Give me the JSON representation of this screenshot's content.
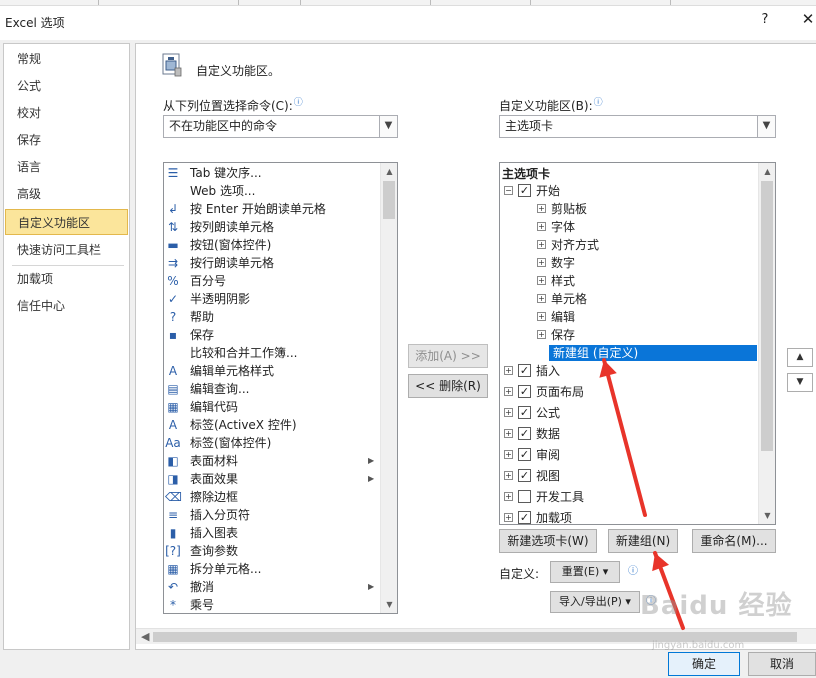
{
  "window": {
    "title": "Excel 选项",
    "help": "?",
    "close": "✕"
  },
  "nav": {
    "items": [
      {
        "label": "常规"
      },
      {
        "label": "公式"
      },
      {
        "label": "校对"
      },
      {
        "label": "保存"
      },
      {
        "label": "语言"
      },
      {
        "label": "高级"
      },
      {
        "label": "自定义功能区"
      },
      {
        "label": "快速访问工具栏"
      },
      {
        "label": "加载项"
      },
      {
        "label": "信任中心"
      }
    ],
    "active_index": 6
  },
  "main": {
    "section_title": "自定义功能区。",
    "choose_commands_label": "从下列位置选择命令(C):",
    "choose_commands_value": "不在功能区中的命令",
    "customize_ribbon_label": "自定义功能区(B):",
    "customize_ribbon_value": "主选项卡",
    "commands": [
      {
        "icon": "tab-order-icon",
        "glyph": "☰",
        "label": "Tab 键次序...",
        "submenu": false
      },
      {
        "icon": "",
        "glyph": "",
        "label": "Web 选项...",
        "submenu": false
      },
      {
        "icon": "speak-on-enter-icon",
        "glyph": "↲",
        "label": "按 Enter 开始朗读单元格",
        "submenu": false
      },
      {
        "icon": "speak-by-columns-icon",
        "glyph": "⇅",
        "label": "按列朗读单元格",
        "submenu": false
      },
      {
        "icon": "button-control-icon",
        "glyph": "▬",
        "label": "按钮(窗体控件)",
        "submenu": false
      },
      {
        "icon": "speak-by-rows-icon",
        "glyph": "⇉",
        "label": "按行朗读单元格",
        "submenu": false
      },
      {
        "icon": "percent-icon",
        "glyph": "%",
        "label": "百分号",
        "submenu": false
      },
      {
        "icon": "checkmark-icon",
        "glyph": "✓",
        "label": "半透明阴影",
        "submenu": false
      },
      {
        "icon": "help-icon",
        "glyph": "?",
        "label": "帮助",
        "submenu": false
      },
      {
        "icon": "save-icon",
        "glyph": "▪",
        "label": "保存",
        "submenu": false
      },
      {
        "icon": "",
        "glyph": "",
        "label": "比较和合并工作簿...",
        "submenu": false
      },
      {
        "icon": "cell-style-icon",
        "glyph": "A",
        "label": "编辑单元格样式",
        "submenu": false
      },
      {
        "icon": "edit-query-icon",
        "glyph": "▤",
        "label": "编辑查询...",
        "submenu": false
      },
      {
        "icon": "edit-code-icon",
        "glyph": "▦",
        "label": "编辑代码",
        "submenu": false
      },
      {
        "icon": "label-activex-icon",
        "glyph": "A",
        "label": "标签(ActiveX 控件)",
        "submenu": false
      },
      {
        "icon": "label-form-icon",
        "glyph": "Aa",
        "label": "标签(窗体控件)",
        "submenu": false
      },
      {
        "icon": "surface-material-icon",
        "glyph": "◧",
        "label": "表面材料",
        "submenu": true
      },
      {
        "icon": "surface-effect-icon",
        "glyph": "◨",
        "label": "表面效果",
        "submenu": true
      },
      {
        "icon": "erase-border-icon",
        "glyph": "⌫",
        "label": "擦除边框",
        "submenu": false
      },
      {
        "icon": "page-break-icon",
        "glyph": "≡",
        "label": "插入分页符",
        "submenu": false
      },
      {
        "icon": "insert-chart-icon",
        "glyph": "▮",
        "label": "插入图表",
        "submenu": false
      },
      {
        "icon": "query-params-icon",
        "glyph": "[?]",
        "label": "查询参数",
        "submenu": false
      },
      {
        "icon": "split-cells-icon",
        "glyph": "▦",
        "label": "拆分单元格...",
        "submenu": false
      },
      {
        "icon": "undo-icon",
        "glyph": "↶",
        "label": "撤消",
        "submenu": true
      },
      {
        "icon": "multiply-icon",
        "glyph": "*",
        "label": "乘号",
        "submenu": false
      }
    ],
    "add_button": "添加(A) >>",
    "remove_button": "<< 删除(R)",
    "tree_header": "主选项卡",
    "tree": [
      {
        "level": 0,
        "expander": "⊟",
        "checked": true,
        "label": "开始",
        "selected": false
      },
      {
        "level": 1,
        "expander": "⊞",
        "checked": null,
        "label": "剪贴板",
        "selected": false
      },
      {
        "level": 1,
        "expander": "⊞",
        "checked": null,
        "label": "字体",
        "selected": false
      },
      {
        "level": 1,
        "expander": "⊞",
        "checked": null,
        "label": "对齐方式",
        "selected": false
      },
      {
        "level": 1,
        "expander": "⊞",
        "checked": null,
        "label": "数字",
        "selected": false
      },
      {
        "level": 1,
        "expander": "⊞",
        "checked": null,
        "label": "样式",
        "selected": false
      },
      {
        "level": 1,
        "expander": "⊞",
        "checked": null,
        "label": "单元格",
        "selected": false
      },
      {
        "level": 1,
        "expander": "⊞",
        "checked": null,
        "label": "编辑",
        "selected": false
      },
      {
        "level": 1,
        "expander": "⊞",
        "checked": null,
        "label": "保存",
        "selected": false
      },
      {
        "level": 1,
        "expander": "",
        "checked": null,
        "label": "新建组 (自定义)",
        "selected": true
      },
      {
        "level": 0,
        "expander": "⊞",
        "checked": true,
        "label": "插入",
        "selected": false
      },
      {
        "level": 0,
        "expander": "⊞",
        "checked": true,
        "label": "页面布局",
        "selected": false
      },
      {
        "level": 0,
        "expander": "⊞",
        "checked": true,
        "label": "公式",
        "selected": false
      },
      {
        "level": 0,
        "expander": "⊞",
        "checked": true,
        "label": "数据",
        "selected": false
      },
      {
        "level": 0,
        "expander": "⊞",
        "checked": true,
        "label": "审阅",
        "selected": false
      },
      {
        "level": 0,
        "expander": "⊞",
        "checked": true,
        "label": "视图",
        "selected": false
      },
      {
        "level": 0,
        "expander": "⊞",
        "checked": false,
        "label": "开发工具",
        "selected": false
      },
      {
        "level": 0,
        "expander": "⊞",
        "checked": true,
        "label": "加载项",
        "selected": false
      }
    ],
    "new_tab_button": "新建选项卡(W)",
    "new_group_button": "新建组(N)",
    "rename_button": "重命名(M)...",
    "customizations_label": "自定义:",
    "reset_button": "重置(E) ▾",
    "import_export_button": "导入/导出(P) ▾",
    "move_up": "▲",
    "move_down": "▼"
  },
  "footer": {
    "ok_button": "确定",
    "cancel_button": "取消"
  },
  "annotation_color": "#e8342a",
  "watermark": {
    "main": "Baidu 经验",
    "sub": "jingyan.baidu.com"
  }
}
